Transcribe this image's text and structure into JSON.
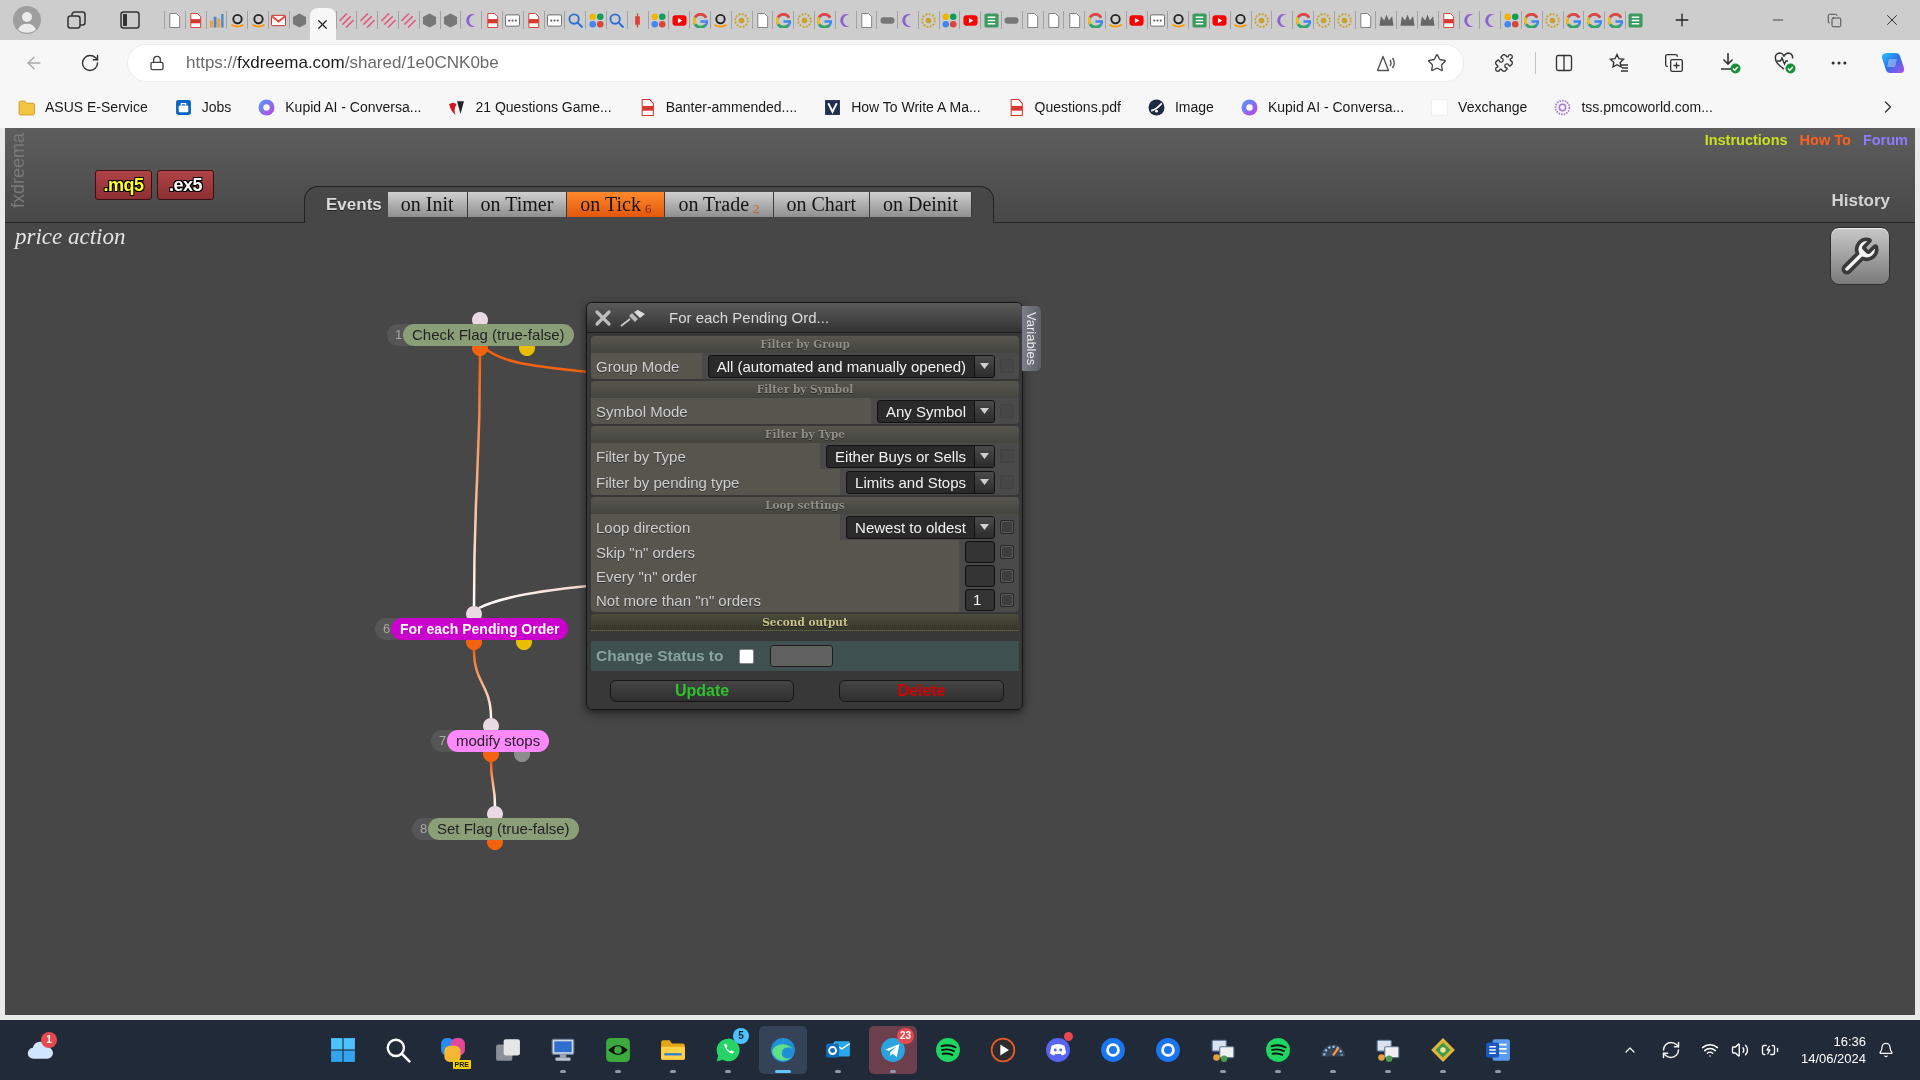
{
  "browser": {
    "tabs": [
      {
        "selected": false
      },
      {
        "selected": false
      },
      {
        "selected": false
      },
      {
        "selected": false
      },
      {
        "selected": false
      },
      {
        "selected": false
      },
      {
        "selected": false
      },
      {
        "selected": true
      },
      {
        "selected": false
      },
      {
        "selected": false
      },
      {
        "selected": false
      },
      {
        "selected": false
      },
      {
        "selected": false
      },
      {
        "selected": false
      },
      {
        "selected": false
      },
      {
        "selected": false
      },
      {
        "selected": false
      },
      {
        "selected": false
      },
      {
        "selected": false
      },
      {
        "selected": false
      },
      {
        "selected": false
      },
      {
        "selected": false
      },
      {
        "selected": false
      },
      {
        "selected": false
      },
      {
        "selected": false
      },
      {
        "selected": false
      },
      {
        "selected": false
      },
      {
        "selected": false
      },
      {
        "selected": false
      },
      {
        "selected": false
      },
      {
        "selected": false
      },
      {
        "selected": false
      },
      {
        "selected": false
      },
      {
        "selected": false
      },
      {
        "selected": false
      },
      {
        "selected": false
      },
      {
        "selected": false
      },
      {
        "selected": false
      },
      {
        "selected": false
      },
      {
        "selected": false
      },
      {
        "selected": false
      },
      {
        "selected": false
      },
      {
        "selected": false
      },
      {
        "selected": false
      },
      {
        "selected": false
      },
      {
        "selected": false
      },
      {
        "selected": false
      },
      {
        "selected": false
      },
      {
        "selected": false
      },
      {
        "selected": false
      },
      {
        "selected": false
      },
      {
        "selected": false
      },
      {
        "selected": false
      },
      {
        "selected": false
      },
      {
        "selected": false
      },
      {
        "selected": false
      },
      {
        "selected": false
      },
      {
        "selected": false
      },
      {
        "selected": false
      },
      {
        "selected": false
      },
      {
        "selected": false
      },
      {
        "selected": false
      },
      {
        "selected": false
      },
      {
        "selected": false
      },
      {
        "selected": false
      },
      {
        "selected": false
      },
      {
        "selected": false
      },
      {
        "selected": false
      },
      {
        "selected": false
      },
      {
        "selected": false
      },
      {
        "selected": false
      }
    ],
    "address": {
      "scheme": "https://",
      "domain": "fxdreema.com",
      "path": "/shared/1e0CNK0be"
    },
    "bookmarks": [
      {
        "label": "ASUS E-Service"
      },
      {
        "label": "Jobs"
      },
      {
        "label": "Kupid AI - Conversa..."
      },
      {
        "label": "21 Questions Game..."
      },
      {
        "label": "Banter-ammended...."
      },
      {
        "label": "How To Write A Ma..."
      },
      {
        "label": "Questions.pdf"
      },
      {
        "label": "Image"
      },
      {
        "label": "Kupid AI - Conversa..."
      },
      {
        "label": "Vexchange"
      },
      {
        "label": "tss.pmcoworld.com..."
      }
    ]
  },
  "app": {
    "brand": "fxdreema",
    "file_buttons": [
      {
        "label": ".mq5",
        "kind": "source"
      },
      {
        "label": ".ex5",
        "kind": "compiled"
      }
    ],
    "events": {
      "label": "Events",
      "tabs": [
        {
          "label": "on Init",
          "selected": false
        },
        {
          "label": "on Timer",
          "selected": false
        },
        {
          "label": "on Tick",
          "count": "6",
          "selected": true
        },
        {
          "label": "on Trade",
          "count": "2",
          "selected": false
        },
        {
          "label": "on Chart",
          "selected": false
        },
        {
          "label": "on Deinit",
          "selected": false
        }
      ]
    },
    "links": [
      {
        "label": "Instructions",
        "color": "#c8e01e"
      },
      {
        "label": "How To",
        "color": "#ff5f1f"
      },
      {
        "label": "Forum",
        "color": "#8c7dff"
      }
    ],
    "history": "History",
    "project_title": "price action",
    "nodes": [
      {
        "number": "1",
        "label": "Check Flag (true-false)",
        "color": "#8a9e78",
        "outputs": [
          {
            "color": "#f2620f"
          },
          {
            "color": "#e8bf00"
          }
        ]
      },
      {
        "number": "6",
        "label": "For each Pending Order",
        "color": "#cc00cc",
        "outputs": [
          {
            "color": "#f2620f"
          },
          {
            "color": "#e8bf00"
          }
        ]
      },
      {
        "number": "7",
        "label": "modify stops",
        "color": "#ff88ff",
        "outputs": [
          {
            "color": "#f2620f"
          },
          {
            "color": "#8c8c8c"
          }
        ]
      },
      {
        "number": "8",
        "label": "Set Flag (true-false)",
        "color": "#8a9e78",
        "outputs": [
          {
            "color": "#f2620f"
          }
        ]
      }
    ],
    "dialog": {
      "title": "For each Pending Ord...",
      "side_tab": "Variables",
      "sections": [
        {
          "title": "Filter by Group",
          "rows": [
            {
              "kind": "select",
              "label": "Group Mode",
              "value": "All (automated and manually opened)",
              "checked": false,
              "disabled": true
            }
          ]
        },
        {
          "title": "Filter by Symbol",
          "rows": [
            {
              "kind": "select",
              "label": "Symbol Mode",
              "value": "Any Symbol",
              "checked": false,
              "disabled": true
            }
          ]
        },
        {
          "title": "Filter by Type",
          "rows": [
            {
              "kind": "select",
              "label": "Filter by Type",
              "value": "Either Buys or Sells",
              "checked": false,
              "disabled": true
            },
            {
              "kind": "select",
              "label": "Filter by pending type",
              "value": "Limits and Stops",
              "checked": false,
              "disabled": true
            }
          ]
        },
        {
          "title": "Loop settings",
          "rows": [
            {
              "kind": "select",
              "label": "Loop direction",
              "value": "Newest to oldest",
              "checked": false,
              "disabled": false
            },
            {
              "kind": "number",
              "label": "Skip \"n\" orders",
              "checked": false,
              "disabled": false
            },
            {
              "kind": "number",
              "label": "Every \"n\" order",
              "checked": false,
              "disabled": false
            },
            {
              "kind": "number",
              "label": "Not more than \"n\" orders",
              "value": "1",
              "checked": false,
              "disabled": false
            }
          ]
        }
      ],
      "second_output": {
        "title": "Second output",
        "label": "Change Status to",
        "checked": false
      },
      "buttons": [
        {
          "label": "Update",
          "kind": "confirm"
        },
        {
          "label": "Delete",
          "kind": "danger"
        }
      ]
    }
  },
  "taskbar": {
    "weather": {
      "badge": {
        "text": "1",
        "color": "#e5484d"
      }
    },
    "apps": [
      {
        "running": false,
        "selected": false,
        "flashing": false
      },
      {
        "running": false,
        "selected": false,
        "flashing": false
      },
      {
        "tag": "PRE",
        "running": false,
        "selected": false,
        "flashing": false
      },
      {
        "running": false,
        "selected": false,
        "flashing": false
      },
      {
        "running": true,
        "selected": false,
        "flashing": false
      },
      {
        "running": true,
        "selected": false,
        "flashing": false
      },
      {
        "running": true,
        "selected": false,
        "flashing": false
      },
      {
        "badge": {
          "text": "5",
          "color": "#4cc2ff"
        },
        "running": true,
        "selected": false,
        "flashing": false
      },
      {
        "running": true,
        "selected": true,
        "flashing": false
      },
      {
        "running": true,
        "selected": false,
        "flashing": false
      },
      {
        "badge": {
          "text": "23",
          "color": "#e5484d"
        },
        "running": true,
        "selected": false,
        "flashing": true
      },
      {
        "running": false,
        "selected": false,
        "flashing": false
      },
      {
        "running": false,
        "selected": false,
        "flashing": false
      },
      {
        "badge": {
          "color": "#e5484d"
        },
        "running": false,
        "selected": false,
        "flashing": false
      },
      {
        "running": false,
        "selected": false,
        "flashing": false
      },
      {
        "running": false,
        "selected": false,
        "flashing": false
      },
      {
        "running": true,
        "selected": false,
        "flashing": false
      },
      {
        "running": true,
        "selected": false,
        "flashing": false
      },
      {
        "running": true,
        "selected": false,
        "flashing": false
      },
      {
        "running": true,
        "selected": false,
        "flashing": false
      },
      {
        "running": true,
        "selected": false,
        "flashing": false
      },
      {
        "running": true,
        "selected": false,
        "flashing": false
      }
    ],
    "clock": {
      "time": "16:36",
      "date": "14/06/2024"
    }
  }
}
